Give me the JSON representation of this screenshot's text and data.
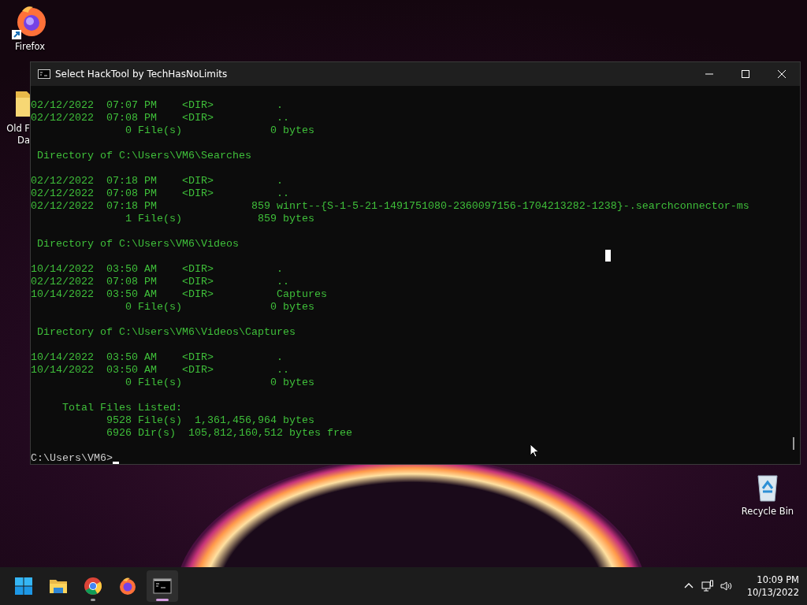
{
  "desktop_icons": [
    {
      "label": "Firefox",
      "kind": "firefox",
      "shortcut": true
    },
    {
      "label": "Old F\nDa",
      "kind": "folder",
      "shortcut": false
    },
    {
      "label": "Recycle Bin",
      "kind": "recycle",
      "shortcut": false
    }
  ],
  "window": {
    "title": "Select HackTool by TechHasNoLimits",
    "output_blocks": [
      [
        "02/12/2022  07:07 PM    <DIR>          .",
        "02/12/2022  07:08 PM    <DIR>          ..",
        "               0 File(s)              0 bytes"
      ],
      [
        " Directory of C:\\Users\\VM6\\Searches"
      ],
      [
        "02/12/2022  07:18 PM    <DIR>          .",
        "02/12/2022  07:08 PM    <DIR>          ..",
        "02/12/2022  07:18 PM               859 winrt--{S-1-5-21-1491751080-2360097156-1704213282-1238}-.searchconnector-ms",
        "               1 File(s)            859 bytes"
      ],
      [
        " Directory of C:\\Users\\VM6\\Videos"
      ],
      [
        "10/14/2022  03:50 AM    <DIR>          .",
        "02/12/2022  07:08 PM    <DIR>          ..",
        "10/14/2022  03:50 AM    <DIR>          Captures",
        "               0 File(s)              0 bytes"
      ],
      [
        " Directory of C:\\Users\\VM6\\Videos\\Captures"
      ],
      [
        "10/14/2022  03:50 AM    <DIR>          .",
        "10/14/2022  03:50 AM    <DIR>          ..",
        "               0 File(s)              0 bytes"
      ],
      [
        "     Total Files Listed:",
        "            9528 File(s)  1,361,456,964 bytes",
        "            6926 Dir(s)  105,812,160,512 bytes free"
      ]
    ],
    "prompt": "C:\\Users\\VM6>"
  },
  "taskbar": {
    "apps": [
      {
        "kind": "start",
        "running": false,
        "active": false
      },
      {
        "kind": "explorer",
        "running": false,
        "active": false
      },
      {
        "kind": "chrome",
        "running": true,
        "active": false
      },
      {
        "kind": "firefox",
        "running": false,
        "active": false
      },
      {
        "kind": "terminal",
        "running": true,
        "active": true
      }
    ],
    "time": "10:09 PM",
    "date": "10/13/2022"
  }
}
